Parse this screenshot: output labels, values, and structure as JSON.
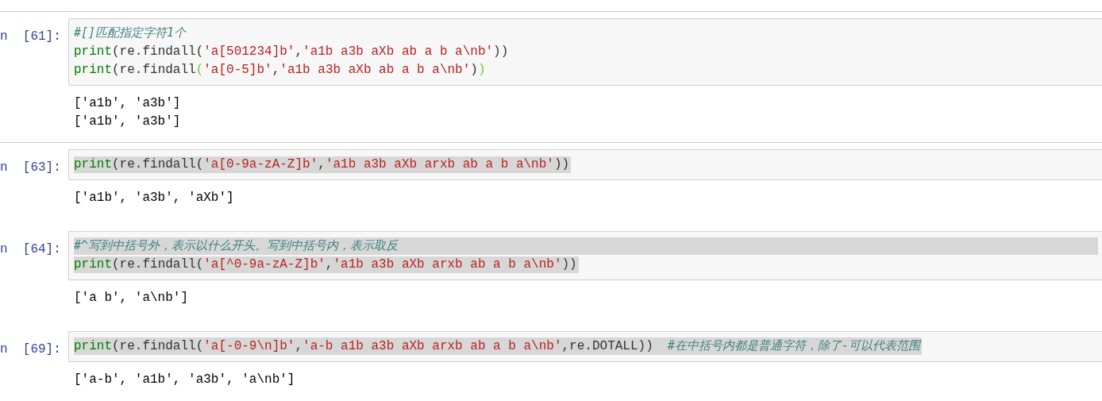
{
  "cells": [
    {
      "prompt": "n  [61]:",
      "input": [
        {
          "selected": false,
          "tokens": [
            {
              "kind": "comment",
              "text": "#[]匹配指定字符1个"
            }
          ]
        },
        {
          "selected": false,
          "tokens": [
            {
              "kind": "builtin",
              "text": "print"
            },
            {
              "kind": "plain",
              "text": "(re.findall("
            },
            {
              "kind": "string",
              "text": "'a[501234]b'"
            },
            {
              "kind": "plain",
              "text": ","
            },
            {
              "kind": "string",
              "text": "'a1b a3b aXb ab a b a\\nb'"
            },
            {
              "kind": "plain",
              "text": "))"
            }
          ]
        },
        {
          "selected": false,
          "tokens": [
            {
              "kind": "builtin",
              "text": "print"
            },
            {
              "kind": "plain",
              "text": "(re.findall"
            },
            {
              "kind": "match",
              "text": "("
            },
            {
              "kind": "string",
              "text": "'a[0-5]b'"
            },
            {
              "kind": "plain",
              "text": ","
            },
            {
              "kind": "string",
              "text": "'a1b a3b aXb ab a b a\\nb'"
            },
            {
              "kind": "plain",
              "text": ")"
            },
            {
              "kind": "match",
              "text": ")"
            }
          ]
        }
      ],
      "output": [
        "['a1b', 'a3b']",
        "['a1b', 'a3b']"
      ]
    },
    {
      "prompt": "n  [63]:",
      "input": [
        {
          "selected": true,
          "selection_to_edge": false,
          "tokens": [
            {
              "kind": "builtin",
              "text": "print"
            },
            {
              "kind": "plain",
              "text": "(re.findall("
            },
            {
              "kind": "string",
              "text": "'a[0-9a-zA-Z]b'"
            },
            {
              "kind": "plain",
              "text": ","
            },
            {
              "kind": "string",
              "text": "'a1b a3b aXb arxb ab a b a\\nb'"
            },
            {
              "kind": "plain",
              "text": "))"
            }
          ]
        }
      ],
      "output": [
        "['a1b', 'a3b', 'aXb']"
      ]
    },
    {
      "prompt": "n  [64]:",
      "input": [
        {
          "selected": true,
          "selection_to_edge": true,
          "tokens": [
            {
              "kind": "comment",
              "text": "#^写到中括号外，表示以什么开头。写到中括号内，表示取反"
            }
          ]
        },
        {
          "selected": true,
          "selection_to_edge": false,
          "tokens": [
            {
              "kind": "builtin",
              "text": "print"
            },
            {
              "kind": "plain",
              "text": "(re.findall("
            },
            {
              "kind": "string",
              "text": "'a[^0-9a-zA-Z]b'"
            },
            {
              "kind": "plain",
              "text": ","
            },
            {
              "kind": "string",
              "text": "'a1b a3b aXb arxb ab a b a\\nb'"
            },
            {
              "kind": "plain",
              "text": "))"
            }
          ]
        }
      ],
      "output": [
        "['a b', 'a\\nb']"
      ]
    },
    {
      "prompt": "n  [69]:",
      "input": [
        {
          "selected": true,
          "selection_to_edge": false,
          "tokens": [
            {
              "kind": "builtin",
              "text": "print"
            },
            {
              "kind": "plain",
              "text": "(re.findall("
            },
            {
              "kind": "string",
              "text": "'a[-0-9\\n]b'"
            },
            {
              "kind": "plain",
              "text": ","
            },
            {
              "kind": "string",
              "text": "'a-b a1b a3b aXb arxb ab a b a\\nb'"
            },
            {
              "kind": "plain",
              "text": ",re.DOTALL))"
            },
            {
              "kind": "comment",
              "text": "  #在中括号内都是普通字符，除了-可以代表范围"
            }
          ]
        }
      ],
      "output": [
        "['a-b', 'a1b', 'a3b', 'a\\nb']"
      ]
    }
  ]
}
